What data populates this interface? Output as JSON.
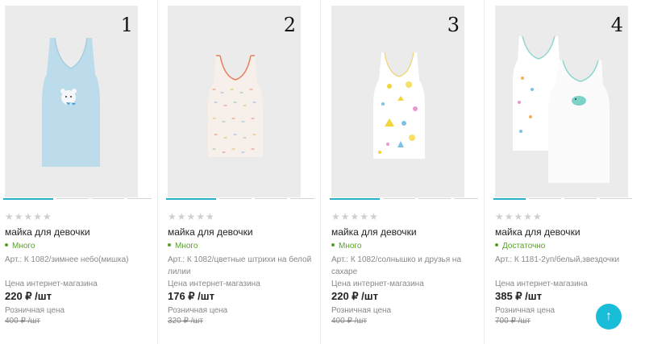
{
  "colors": {
    "accent": "#26b0c8",
    "in_stock": "#5aa02c",
    "to_top_button": "#19bdd7"
  },
  "products": [
    {
      "number": "1",
      "stars": "★★★★★",
      "title": "майка для девочки",
      "stock": "Много",
      "article": "Арт.: К 1082/зимнее небо(мишка)",
      "price_label": "Цена интернет-магазина",
      "price": "220 ₽ /шт",
      "retail_label": "Розничная цена",
      "retail_price": "400 ₽ /шт",
      "image": "light-blue-tank-top-with-bear"
    },
    {
      "number": "2",
      "stars": "★★★★★",
      "title": "майка для девочки",
      "stock": "Много",
      "article": "Арт.: К 1082/цветные штрихи на белой лилии",
      "price_label": "Цена интернет-магазина",
      "price": "176 ₽ /шт",
      "retail_label": "Розничная цена",
      "retail_price": "320 ₽ /шт",
      "image": "white-tank-top-colored-strokes"
    },
    {
      "number": "3",
      "stars": "★★★★★",
      "title": "майка для девочки",
      "stock": "Много",
      "article": "Арт.: К 1082/солнышко и друзья на сахаре",
      "price_label": "Цена интернет-магазина",
      "price": "220 ₽ /шт",
      "retail_label": "Розничная цена",
      "retail_price": "400 ₽ /шт",
      "image": "white-tank-top-sunshine-friends"
    },
    {
      "number": "4",
      "stars": "★★★★★",
      "title": "майка для девочки",
      "stock": "Достаточно",
      "article": "Арт.: К 1181-2уп/белый,звездочки",
      "price_label": "Цена интернет-магазина",
      "price": "385 ₽ /шт",
      "retail_label": "Розничная цена",
      "retail_price": "700 ₽ /шт",
      "image": "two-pack-white-tank-tops-stars"
    }
  ],
  "scroll_to_top": "↑"
}
